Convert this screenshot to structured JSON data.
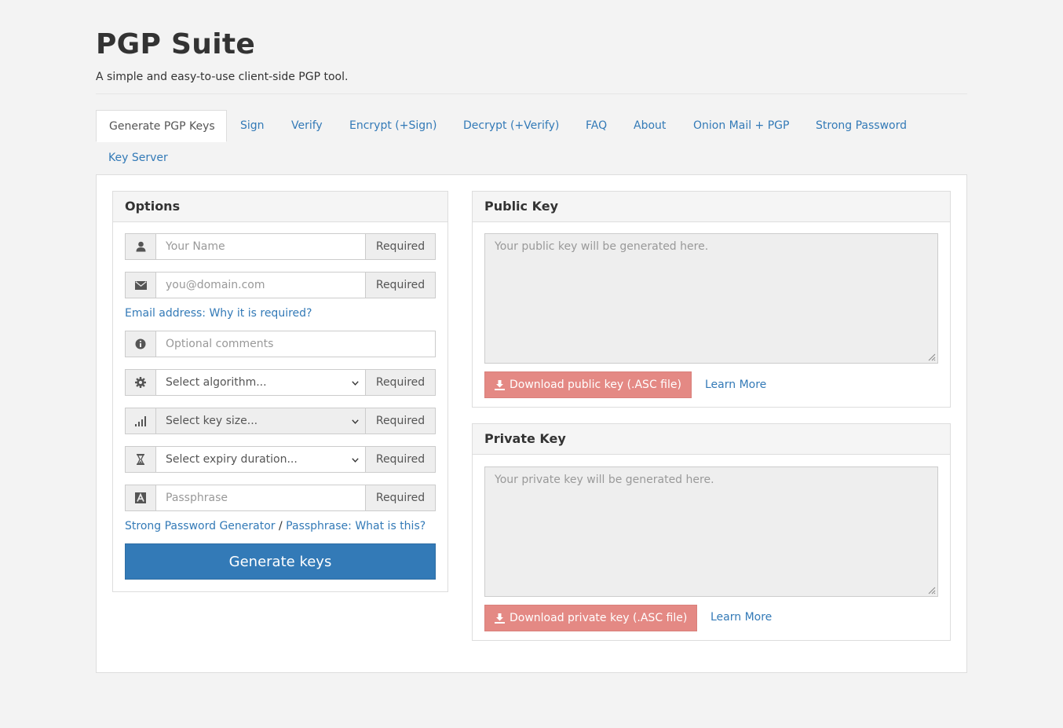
{
  "header": {
    "title": "PGP Suite",
    "subtitle": "A simple and easy-to-use client-side PGP tool."
  },
  "tabs": [
    {
      "label": "Generate PGP Keys",
      "active": true
    },
    {
      "label": "Sign"
    },
    {
      "label": "Verify"
    },
    {
      "label": "Encrypt (+Sign)"
    },
    {
      "label": "Decrypt (+Verify)"
    },
    {
      "label": "FAQ"
    },
    {
      "label": "About"
    },
    {
      "label": "Onion Mail + PGP"
    },
    {
      "label": "Strong Password"
    },
    {
      "label": "Key Server"
    }
  ],
  "options": {
    "heading": "Options",
    "name_placeholder": "Your Name",
    "email_placeholder": "you@domain.com",
    "required_label": "Required",
    "email_help": "Email address: Why it is required?",
    "comments_placeholder": "Optional comments",
    "algorithm_select": "Select algorithm...",
    "keysize_select": "Select key size...",
    "expiry_select": "Select expiry duration...",
    "passphrase_placeholder": "Passphrase",
    "password_generator_link": "Strong Password Generator",
    "separator": "/",
    "passphrase_help_link": "Passphrase: What is this?",
    "generate_button": "Generate keys",
    "icons": [
      "user-icon",
      "envelope-icon",
      "info-icon",
      "gear-icon",
      "signal-icon",
      "hourglass-icon",
      "font-icon"
    ]
  },
  "public_key": {
    "heading": "Public Key",
    "placeholder": "Your public key will be generated here.",
    "download_button": "Download public key (.ASC file)",
    "learn_more": "Learn More"
  },
  "private_key": {
    "heading": "Private Key",
    "placeholder": "Your private key will be generated here.",
    "download_button": "Download private key (.ASC file)",
    "learn_more": "Learn More"
  },
  "colors": {
    "primary": "#337ab7",
    "danger_light": "#e48984",
    "background": "#f3f3f3"
  }
}
